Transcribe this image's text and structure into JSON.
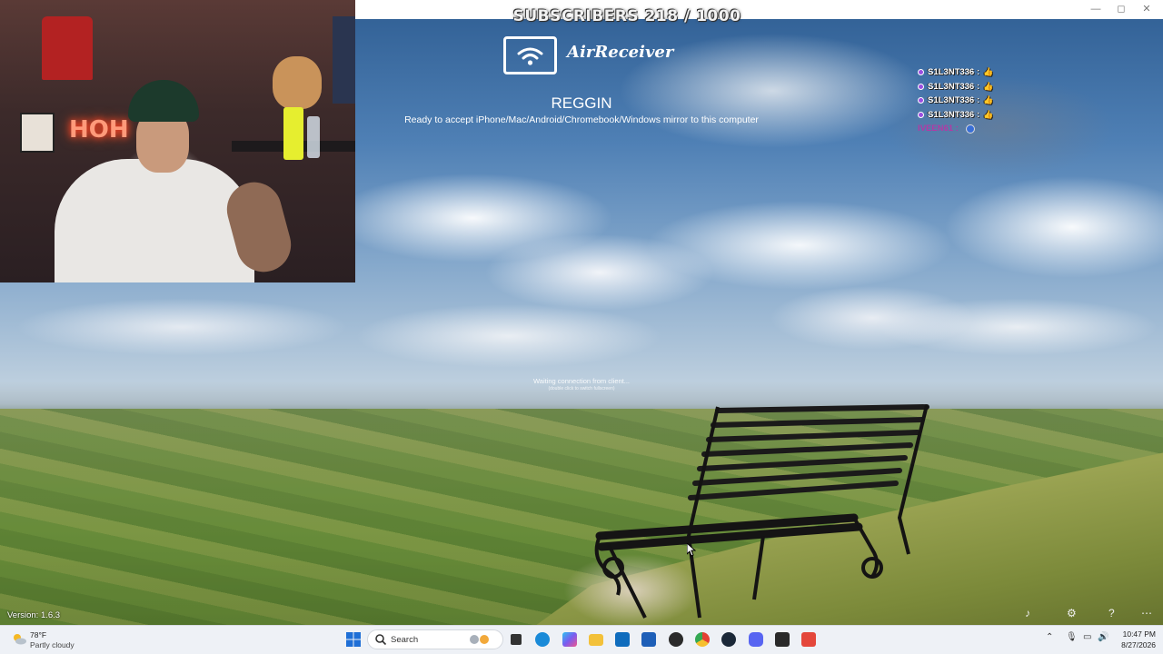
{
  "window": {
    "title_overlay": "SUBSCRIBERS 218 / 1000",
    "controls": {
      "minimize": "—",
      "maximize": "◻",
      "close": "✕"
    }
  },
  "airreceiver": {
    "logo_text": "AirReceiver",
    "device_name": "REGGIN",
    "ready_text": "Ready to accept iPhone/Mac/Android/Chromebook/Windows mirror to this computer",
    "waiting_text": "Waiting connection from client...",
    "waiting_subtext": "(double click to switch fullscreen)",
    "version": "Version: 1.6.3"
  },
  "chat": {
    "messages": [
      {
        "user": "S1L3NT336 :",
        "emote": "👍"
      },
      {
        "user": "S1L3NT336 :",
        "emote": "👍"
      },
      {
        "user": "S1L3NT336 :",
        "emote": "👍"
      },
      {
        "user": "S1L3NT336 :",
        "emote": "👍"
      }
    ],
    "last_user": "IVEEN61 :"
  },
  "webcam": {
    "neon_text": "HOH"
  },
  "taskbar": {
    "weather": {
      "temp": "78°F",
      "desc": "Partly cloudy",
      "icon": "partly-cloudy-icon"
    },
    "search_placeholder": "Search",
    "clock": {
      "time": "10:47 PM",
      "date": "8/27/2026"
    },
    "apps": [
      {
        "name": "start-icon",
        "color": "#1f6fd6"
      },
      {
        "name": "task-view-icon",
        "color": "#333333"
      },
      {
        "name": "edge-icon",
        "color": "#1a8ad8"
      },
      {
        "name": "copilot-icon",
        "color": "#7a5cf0"
      },
      {
        "name": "file-explorer-icon",
        "color": "#f3c13a"
      },
      {
        "name": "outlook-icon",
        "color": "#0f6cbd"
      },
      {
        "name": "ms-store-icon",
        "color": "#1e5fb8"
      },
      {
        "name": "obs-icon",
        "color": "#2b2b2b"
      },
      {
        "name": "chrome-icon",
        "color": "#e44134"
      },
      {
        "name": "steam-icon",
        "color": "#1b2838"
      },
      {
        "name": "discord-icon",
        "color": "#5865f2"
      },
      {
        "name": "epic-games-icon",
        "color": "#2a2a2a"
      },
      {
        "name": "airreceiver-icon",
        "color": "#e4473b"
      }
    ]
  }
}
